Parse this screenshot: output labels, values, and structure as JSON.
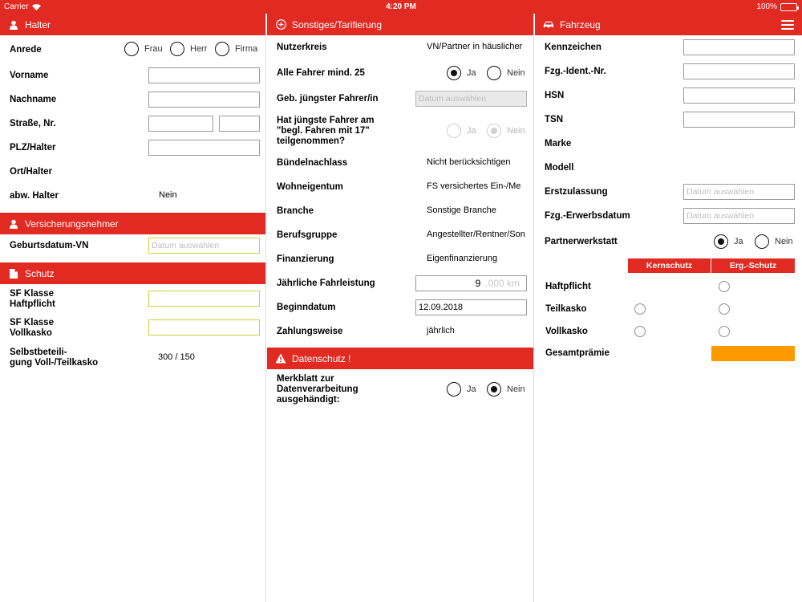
{
  "status": {
    "carrier": "Carrier",
    "time": "4:20 PM",
    "battery": "100%"
  },
  "col1": {
    "halter": {
      "title": "Halter",
      "anrede_label": "Anrede",
      "anrede_options": [
        "Frau",
        "Herr",
        "Firma"
      ],
      "vorname_label": "Vorname",
      "nachname_label": "Nachname",
      "strasse_label": "Straße, Nr.",
      "plz_label": "PLZ/Halter",
      "ort_label": "Ort/Halter",
      "abw_label": "abw. Halter",
      "abw_value": "Nein"
    },
    "vn": {
      "title": "Versicherungsnehmer",
      "geburt_label": "Geburtsdatum-VN",
      "geburt_placeholder": "Datum auswählen"
    },
    "schutz": {
      "title": "Schutz",
      "sf_haft_label_1": "SF Klasse",
      "sf_haft_label_2": "Haftpflicht",
      "sf_voll_label_1": "SF Klasse",
      "sf_voll_label_2": "Vollkasko",
      "sb_label_1": "Selbstbeteili-",
      "sb_label_2": "gung Voll-/Teilkasko",
      "sb_value": "300 / 150"
    }
  },
  "col2": {
    "sonstiges": {
      "title": "Sonstiges/Tarifierung",
      "nutzerkreis_label": "Nutzerkreis",
      "nutzerkreis_value": "VN/Partner in häuslicher",
      "alle_fahrer_label": "Alle Fahrer mind. 25",
      "ja": "Ja",
      "nein": "Nein",
      "geb_label": "Geb. jüngster Fahrer/in",
      "geb_placeholder": "Datum auswählen",
      "begl_label_1": "Hat jüngste Fahrer am",
      "begl_label_2": "\"begl. Fahren mit 17\"",
      "begl_label_3": "teilgenommen?",
      "buendel_label": "Bündelnachlass",
      "buendel_value": "Nicht berücksichtigen",
      "wohn_label": "Wohneigentum",
      "wohn_value": "FS versichertes Ein-/Me",
      "branche_label": "Branche",
      "branche_value": "Sonstige Branche",
      "beruf_label": "Berufsgruppe",
      "beruf_value": "Angestellter/Rentner/Son",
      "finanz_label": "Finanzierung",
      "finanz_value": "Eigenfinanzierung",
      "fahrleistung_label": "Jährliche Fahrleistung",
      "fahrleistung_value": "9",
      "fahrleistung_suffix": ".000 km",
      "beginn_label": "Beginndatum",
      "beginn_value": "12.09.2018",
      "zahlung_label": "Zahlungsweise",
      "zahlung_value": "jährlich"
    },
    "datenschutz": {
      "title": "Datenschutz !",
      "merk_label_1": "Merkblatt zur",
      "merk_label_2": "Datenverarbeitung",
      "merk_label_3": "ausgehändigt:",
      "ja": "Ja",
      "nein": "Nein"
    }
  },
  "col3": {
    "fahrzeug": {
      "title": "Fahrzeug",
      "kennzeichen_label": "Kennzeichen",
      "fzg_ident_label": "Fzg.-Ident.-Nr.",
      "hsn_label": "HSN",
      "tsn_label": "TSN",
      "marke_label": "Marke",
      "modell_label": "Modell",
      "erstzul_label": "Erstzulassung",
      "erstzul_placeholder": "Datum auswählen",
      "erwerb_label": "Fzg.-Erwerbsdatum",
      "erwerb_placeholder": "Datum auswählen",
      "partner_label": "Partnerwerkstatt",
      "ja": "Ja",
      "nein": "Nein",
      "th_kern": "Kernschutz",
      "th_erg": "Erg.-Schutz",
      "haft_label": "Haftpflicht",
      "teil_label": "Teilkasko",
      "voll_label": "Vollkasko",
      "gesamt_label": "Gesamtprämie"
    }
  }
}
